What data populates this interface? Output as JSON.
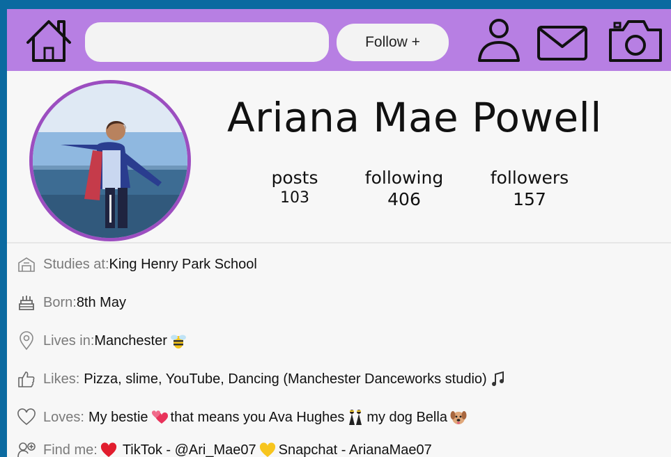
{
  "topbar": {
    "follow_label": "Follow +",
    "search_placeholder": "",
    "icons": [
      "home-icon",
      "profile-icon",
      "mail-icon",
      "camera-icon"
    ]
  },
  "profile": {
    "name": "Ariana Mae Powell",
    "stats": [
      {
        "label": "posts",
        "value": "103"
      },
      {
        "label": "following",
        "value": "406"
      },
      {
        "label": "followers",
        "value": "157"
      }
    ]
  },
  "info": {
    "studies_label": "Studies at:",
    "studies_value": "King Henry Park School",
    "born_label": "Born:",
    "born_value": "8th May",
    "lives_label": "Lives in:",
    "lives_value": "Manchester",
    "likes_label": "Likes:",
    "likes_value": "Pizza, slime, YouTube, Dancing (Manchester Danceworks studio)",
    "loves_label": "Loves:",
    "loves_value_1": "My bestie",
    "loves_value_2": "that means you Ava Hughes",
    "loves_value_3": "my dog Bella",
    "findme_label": "Find me:",
    "findme_value_1": "TikTok - @Ari_Mae07",
    "findme_value_2": "Snapchat - ArianaMae07"
  },
  "colors": {
    "page_border": "#0b6aa0",
    "topbar": "#b77fe3",
    "avatar_ring": "#9c4ec0"
  }
}
